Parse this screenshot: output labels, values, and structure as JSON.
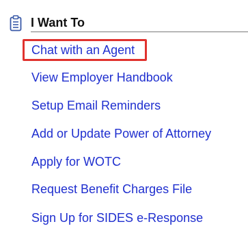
{
  "section": {
    "title": "I Want To",
    "icon": "clipboard-icon",
    "accent_color": "#1f2fcf",
    "icon_color": "#3a5aa8",
    "highlight_color": "#e0322e"
  },
  "links": [
    {
      "label": "Chat with an Agent",
      "highlighted": true
    },
    {
      "label": "View Employer Handbook",
      "highlighted": false
    },
    {
      "label": "Setup Email Reminders",
      "highlighted": false
    },
    {
      "label": "Add or Update Power of Attorney",
      "highlighted": false
    },
    {
      "label": "Apply for WOTC",
      "highlighted": false
    },
    {
      "label": "Request Benefit Charges File",
      "highlighted": false
    },
    {
      "label": "Sign Up for SIDES e-Response",
      "highlighted": false
    }
  ]
}
